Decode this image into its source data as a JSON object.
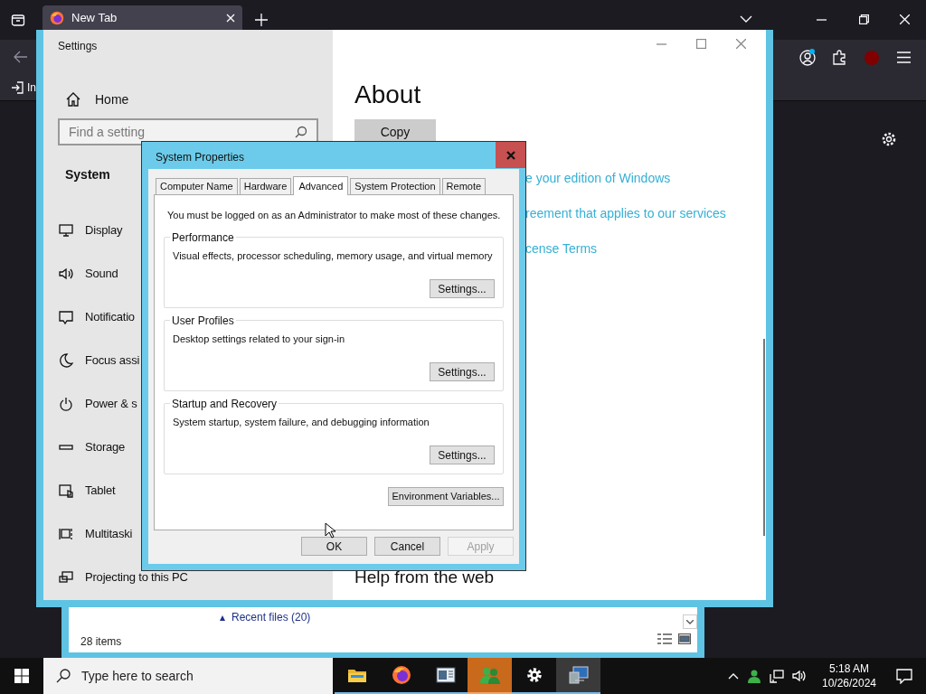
{
  "browser": {
    "tab_title": "New Tab",
    "import_label": "In"
  },
  "settings": {
    "title": "Settings",
    "home": "Home",
    "search": {
      "placeholder": "Find a setting"
    },
    "section": "System",
    "nav": [
      {
        "kind": "display",
        "label": "Display"
      },
      {
        "kind": "sound",
        "label": "Sound"
      },
      {
        "kind": "notifications",
        "label": "Notificatio"
      },
      {
        "kind": "focus",
        "label": "Focus assi"
      },
      {
        "kind": "power",
        "label": "Power & s"
      },
      {
        "kind": "storage",
        "label": "Storage"
      },
      {
        "kind": "tablet",
        "label": "Tablet"
      },
      {
        "kind": "multitasking",
        "label": "Multitaski"
      },
      {
        "kind": "projecting",
        "label": "Projecting to this PC"
      }
    ],
    "heading": "About",
    "copy_button": "Copy",
    "links": [
      "e your edition of Windows",
      "reement that applies to our services",
      "cense Terms"
    ],
    "help_heading": "Help from the web"
  },
  "dialog": {
    "title": "System Properties",
    "tabs": [
      {
        "label": "Computer Name",
        "selected": false
      },
      {
        "label": "Hardware",
        "selected": false
      },
      {
        "label": "Advanced",
        "selected": true
      },
      {
        "label": "System Protection",
        "selected": false
      },
      {
        "label": "Remote",
        "selected": false
      }
    ],
    "notice": "You must be logged on as an Administrator to make most of these changes.",
    "groups": [
      {
        "title": "Performance",
        "description": "Visual effects, processor scheduling, memory usage, and virtual memory",
        "button": "Settings..."
      },
      {
        "title": "User Profiles",
        "description": "Desktop settings related to your sign-in",
        "button": "Settings..."
      },
      {
        "title": "Startup and Recovery",
        "description": "System startup, system failure, and debugging information",
        "button": "Settings..."
      }
    ],
    "env_button": "Environment Variables...",
    "buttons": [
      {
        "label": "OK",
        "disabled": false
      },
      {
        "label": "Cancel",
        "disabled": false
      },
      {
        "label": "Apply",
        "disabled": true
      }
    ]
  },
  "explorer": {
    "collapse_glyph": "▴",
    "group_header": "Recent files (20)",
    "status": "28 items"
  },
  "taskbar": {
    "search": {
      "placeholder": "Type here to search"
    },
    "apps": [
      {
        "kind": "folder",
        "selected": false
      },
      {
        "kind": "firefox",
        "selected": false
      },
      {
        "kind": "document",
        "selected": false
      },
      {
        "kind": "people",
        "selected": true
      },
      {
        "kind": "gear",
        "selected": false
      },
      {
        "kind": "computer",
        "selected": false
      }
    ],
    "time": "5:18 AM",
    "date": "10/26/2024"
  }
}
